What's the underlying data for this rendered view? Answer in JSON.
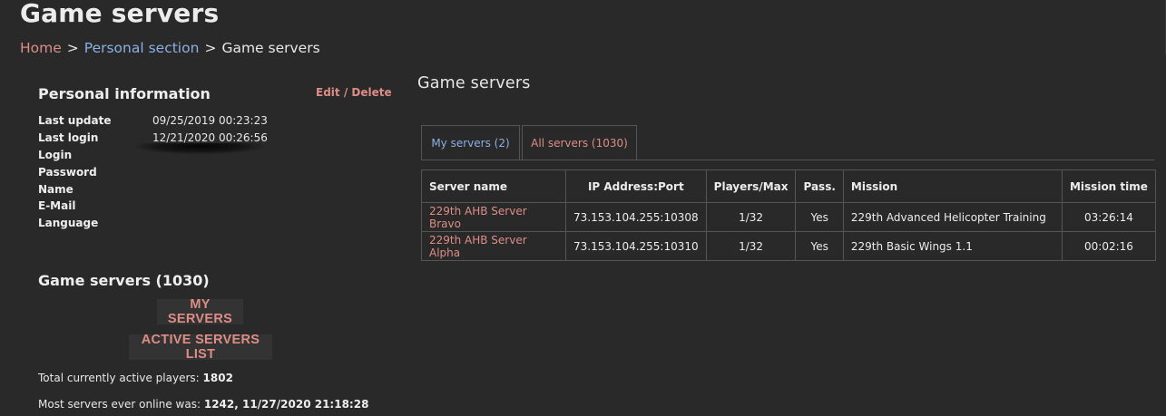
{
  "page": {
    "title": "Game servers"
  },
  "breadcrumb": {
    "home": "Home",
    "personal": "Personal section",
    "current": "Game servers",
    "separator": ">"
  },
  "personal_info": {
    "heading": "Personal information",
    "edit_label": "Edit / Delete",
    "rows": [
      {
        "label": "Last update",
        "value": "09/25/2019 00:23:23"
      },
      {
        "label": "Last login",
        "value": "12/21/2020 00:26:56"
      },
      {
        "label": "Login",
        "value": ""
      },
      {
        "label": "Password",
        "value": ""
      },
      {
        "label": "Name",
        "value": ""
      },
      {
        "label": "E-Mail",
        "value": ""
      },
      {
        "label": "Language",
        "value": ""
      }
    ]
  },
  "sidebar_servers": {
    "heading": "Game servers (1030)",
    "my_servers_label": "MY SERVERS",
    "active_list_label": "ACTIVE SERVERS LIST",
    "active_players_label": "Total currently active players:",
    "active_players_value": "1802",
    "most_online_label": "Most servers ever online was:",
    "most_online_value": "1242, 11/27/2020 21:18:28"
  },
  "main": {
    "heading": "Game servers",
    "tabs": [
      {
        "label": "My servers (2)"
      },
      {
        "label": "All servers (1030)"
      }
    ],
    "table": {
      "columns": [
        "Server name",
        "IP Address:Port",
        "Players/Max",
        "Pass.",
        "Mission",
        "Mission time"
      ],
      "rows": [
        {
          "name": "229th AHB Server Bravo",
          "ip": "73.153.104.255:10308",
          "players": "1/32",
          "pass": "Yes",
          "mission": "229th Advanced Helicopter Training",
          "time": "03:26:14"
        },
        {
          "name": "229th AHB Server Alpha",
          "ip": "73.153.104.255:10310",
          "players": "1/32",
          "pass": "Yes",
          "mission": "229th Basic Wings 1.1",
          "time": "00:02:16"
        }
      ]
    }
  },
  "colors": {
    "background": "#292929",
    "link_red": "#dd8d86",
    "link_blue": "#8ab0e4",
    "border": "#555555"
  }
}
